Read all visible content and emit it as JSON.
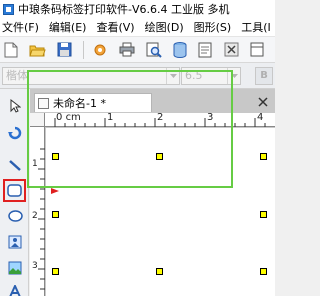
{
  "window": {
    "title": "中琅条码标签打印软件-V6.6.4 工业版 多机"
  },
  "menubar": {
    "items": [
      "文件(F)",
      "编辑(E)",
      "查看(V)",
      "绘图(D)",
      "图形(S)",
      "工具(I"
    ]
  },
  "format_toolbar": {
    "font_name": "楷体",
    "font_size": "6.5",
    "bold_label": "B"
  },
  "document": {
    "tab_title": "未命名-1 *"
  },
  "ruler": {
    "unit": "cm",
    "horizontal_labels": [
      "0",
      "1",
      "2",
      "3",
      "4"
    ],
    "vertical_labels": [
      "1",
      "2",
      "3"
    ]
  },
  "colors": {
    "shape_border": "#66cc44",
    "handle_fill": "#ffff00",
    "selection_highlight": "#e02020"
  },
  "left_toolbar": {
    "tools": [
      "pointer-tool",
      "pan-tool",
      "line-tool",
      "rectangle-tool",
      "ellipse-tool",
      "image-tool",
      "picture-tool",
      "text-tool"
    ],
    "selected": "rectangle-tool"
  }
}
